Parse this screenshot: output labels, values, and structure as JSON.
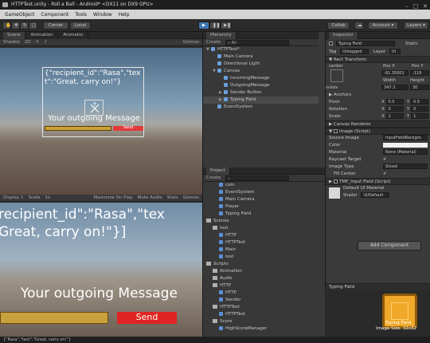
{
  "window": {
    "title": "HTTPTest.unity - Roll a Ball - Android* <DX11 on DX9 GPU>"
  },
  "menu": [
    "GameObject",
    "Component",
    "Tools",
    "Window",
    "Help"
  ],
  "toolbar": {
    "center": "Center",
    "local": "Local",
    "collab": "Collab",
    "account": "Account",
    "layers": "Layers"
  },
  "scene": {
    "tabs": [
      "Scene",
      "Animation",
      "Animator"
    ],
    "shading": "Shaded",
    "mode": "2D",
    "gizmos": "Gizmos",
    "json_text": "{\"recipient_id\":\"Rasa\",\"text\":\"Great, carry on!\"}",
    "outgoing_label": "Your outgoing Message",
    "send_label": "Send"
  },
  "game": {
    "tabs": [
      "Game"
    ],
    "display": "Display 1",
    "scale_label": "Scale",
    "scale_value": "1x",
    "maximize": "Maximize On Play",
    "mute": "Mute Audio",
    "stats": "Stats",
    "gizmos": "Gizmos",
    "json_line1": "recipient_id\":\"Rasa\",\"tex",
    "json_line2": "Great, carry on!\"}]",
    "outgoing_label": "Your outgoing Message",
    "send_label": "Send"
  },
  "hierarchy": {
    "title": "Hierarchy",
    "create": "Create",
    "search_placeholder": "All",
    "items": [
      {
        "label": "HTTPTest*",
        "depth": 0,
        "arrow": "▼"
      },
      {
        "label": "Main Camera",
        "depth": 1,
        "arrow": ""
      },
      {
        "label": "Directional Light",
        "depth": 1,
        "arrow": ""
      },
      {
        "label": "Canvas",
        "depth": 1,
        "arrow": "▼"
      },
      {
        "label": "IncomingMessage",
        "depth": 2,
        "arrow": ""
      },
      {
        "label": "OutgoingMessage",
        "depth": 2,
        "arrow": ""
      },
      {
        "label": "Sender Button",
        "depth": 2,
        "arrow": "▶"
      },
      {
        "label": "Typing Field",
        "depth": 2,
        "arrow": "▶",
        "selected": true
      },
      {
        "label": "EventSystem",
        "depth": 1,
        "arrow": ""
      }
    ]
  },
  "project": {
    "title": "Project",
    "create": "Create",
    "items": [
      {
        "label": "coin",
        "depth": 2,
        "folder": false
      },
      {
        "label": "EventSystem",
        "depth": 2,
        "folder": false
      },
      {
        "label": "Main Camera",
        "depth": 2,
        "folder": false
      },
      {
        "label": "Player",
        "depth": 2,
        "folder": false
      },
      {
        "label": "Typing Field",
        "depth": 2,
        "folder": false
      },
      {
        "label": "Scenes",
        "depth": 0,
        "folder": true
      },
      {
        "label": "test",
        "depth": 1,
        "folder": true
      },
      {
        "label": "HTTP",
        "depth": 2,
        "folder": false
      },
      {
        "label": "HTTPTest",
        "depth": 2,
        "folder": false
      },
      {
        "label": "Main",
        "depth": 2,
        "folder": false
      },
      {
        "label": "test",
        "depth": 2,
        "folder": false
      },
      {
        "label": "Scripts",
        "depth": 0,
        "folder": true
      },
      {
        "label": "Animation",
        "depth": 1,
        "folder": true
      },
      {
        "label": "Audio",
        "depth": 1,
        "folder": true
      },
      {
        "label": "HTTP",
        "depth": 1,
        "folder": true
      },
      {
        "label": "HTTP",
        "depth": 2,
        "folder": false
      },
      {
        "label": "Sender",
        "depth": 2,
        "folder": false
      },
      {
        "label": "HTTPTest",
        "depth": 1,
        "folder": true
      },
      {
        "label": "HTTPTest",
        "depth": 2,
        "folder": false
      },
      {
        "label": "Score",
        "depth": 1,
        "folder": true
      },
      {
        "label": "HighScoreManager",
        "depth": 2,
        "folder": false
      }
    ]
  },
  "inspector": {
    "title": "Inspector",
    "object_name": "Typing Field",
    "static_label": "Static",
    "tag_label": "Tag",
    "tag_value": "Untagged",
    "layer_label": "Layer",
    "layer_value": "UI",
    "rect_transform": "Rect Transform",
    "anchor_label": "center",
    "pos_x_label": "Pos X",
    "pos_y_label": "Pos Y",
    "width_label": "Width",
    "height_label": "Height",
    "pos_x": "-91.35001",
    "pos_y": "-119",
    "width": "347.3",
    "height": "30",
    "middle_label": "middle",
    "anchors_label": "Anchors",
    "pivot_label": "Pivot",
    "pivot_x": "0.5",
    "pivot_y": "0.5",
    "rotation_label": "Rotation",
    "rot_x": "0",
    "rot_y": "0",
    "scale_label": "Scale",
    "scale_x": "1",
    "scale_y": "1",
    "canvas_renderer": "Canvas Renderer",
    "image_script": "Image (Script)",
    "source_image_label": "Source Image",
    "source_image_value": "InputFieldBackgro",
    "color_label": "Color",
    "material_label": "Material",
    "material_value": "None (Material)",
    "raycast_label": "Raycast Target",
    "image_type_label": "Image Type",
    "image_type_value": "Sliced",
    "fill_center_label": "Fill Center",
    "tmp_input": "TMP_Input Field (Script)",
    "default_material": "Default UI Material",
    "shader_label": "Shader",
    "shader_value": "UI/Default",
    "add_component": "Add Component",
    "bottom_label": "Typing Field",
    "preview_label": "Typing Field",
    "preview_size": "Image Size: 32x32"
  },
  "status": "{\"Rasa\",\"text\":\"Great, carry on!\"}"
}
